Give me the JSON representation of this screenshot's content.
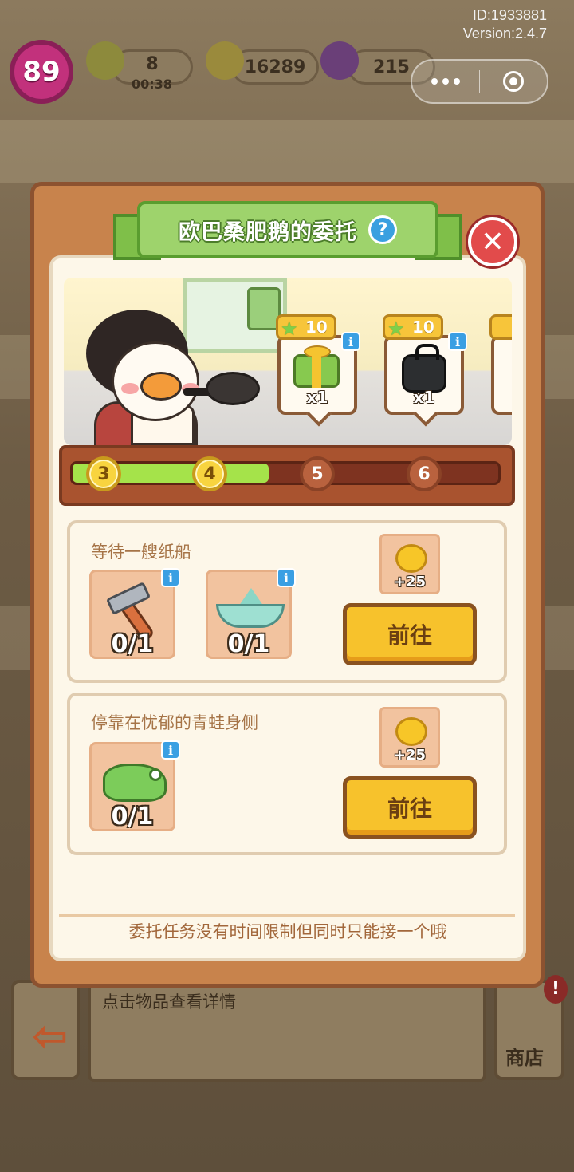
{
  "hud": {
    "level": "89",
    "energy_value": "8",
    "energy_timer": "00:38",
    "coins": "16289",
    "gems": "215",
    "id_label": "ID:1933881",
    "version_label": "Version:2.4.7",
    "more_icon": "more-dots-icon",
    "close_app_icon": "target-ring-icon"
  },
  "dialog": {
    "title": "欧巴桑肥鹅的委托",
    "help_glyph": "?",
    "close_glyph": "✕",
    "rewards": [
      {
        "stars": "10",
        "item": "gift-box",
        "qty": "x1"
      },
      {
        "stars": "10",
        "item": "black-handbag",
        "qty": "x1"
      }
    ],
    "progress": {
      "nodes": [
        "3",
        "4",
        "5",
        "6"
      ],
      "completed_nodes": 2,
      "fill_fraction": 0.46
    },
    "tasks": [
      {
        "title": "等待一艘纸船",
        "items": [
          {
            "name": "hammer",
            "count": "0/1"
          },
          {
            "name": "paper-boat",
            "count": "0/1"
          }
        ],
        "reward": "+25",
        "button": "前往"
      },
      {
        "title": "停靠在忧郁的青蛙身侧",
        "items": [
          {
            "name": "origami-frog",
            "count": "0/1"
          }
        ],
        "reward": "+25",
        "button": "前往"
      }
    ],
    "footer": "委托任务没有时间限制但同时只能接一个哦"
  },
  "bottom": {
    "hint": "点击物品查看详情",
    "shop_label": "商店",
    "shop_alert": "!"
  },
  "colors": {
    "dialog_frame": "#c8834c",
    "banner_green": "#9ed36c",
    "progress_fill": "#a5e34a",
    "button_yellow": "#f7c22c",
    "close_red": "#e24b4b"
  }
}
